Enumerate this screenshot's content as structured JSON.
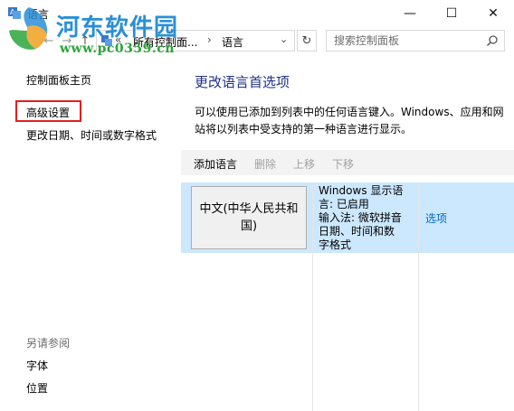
{
  "window": {
    "title": "语言",
    "minimize_glyph": "—",
    "maximize_glyph": "☐",
    "close_glyph": "✕"
  },
  "watermark": {
    "title": "河东软件园",
    "url": "www.pc0359.cn"
  },
  "address": {
    "chevron": "«",
    "segment1": "所有控制面...",
    "separator": "›",
    "segment2": "语言"
  },
  "search": {
    "placeholder": "搜索控制面板"
  },
  "sidebar": {
    "home": "控制面板主页",
    "advanced": "高级设置",
    "date_format": "更改日期、时间或数字格式",
    "see_also": "另请参阅",
    "fonts": "字体",
    "location": "位置"
  },
  "main": {
    "title": "更改语言首选项",
    "description": "可以使用已添加到列表中的任何语言键入。Windows、应用和网站将以列表中受支持的第一种语言进行显示。",
    "toolbar": {
      "add": "添加语言",
      "remove": "删除",
      "move_up": "上移",
      "move_down": "下移"
    },
    "languages": [
      {
        "name": "中文(中华人民共和国)",
        "info_lines": [
          "Windows 显示语",
          "言: 已启用",
          "输入法: 微软拼音",
          "日期、时间和数",
          "字格式"
        ],
        "options": "选项"
      }
    ]
  },
  "colors": {
    "title_blue": "#1e3287",
    "link_blue": "#0066cc",
    "selected_row": "#cce8ff",
    "highlight_red": "#e02020"
  }
}
